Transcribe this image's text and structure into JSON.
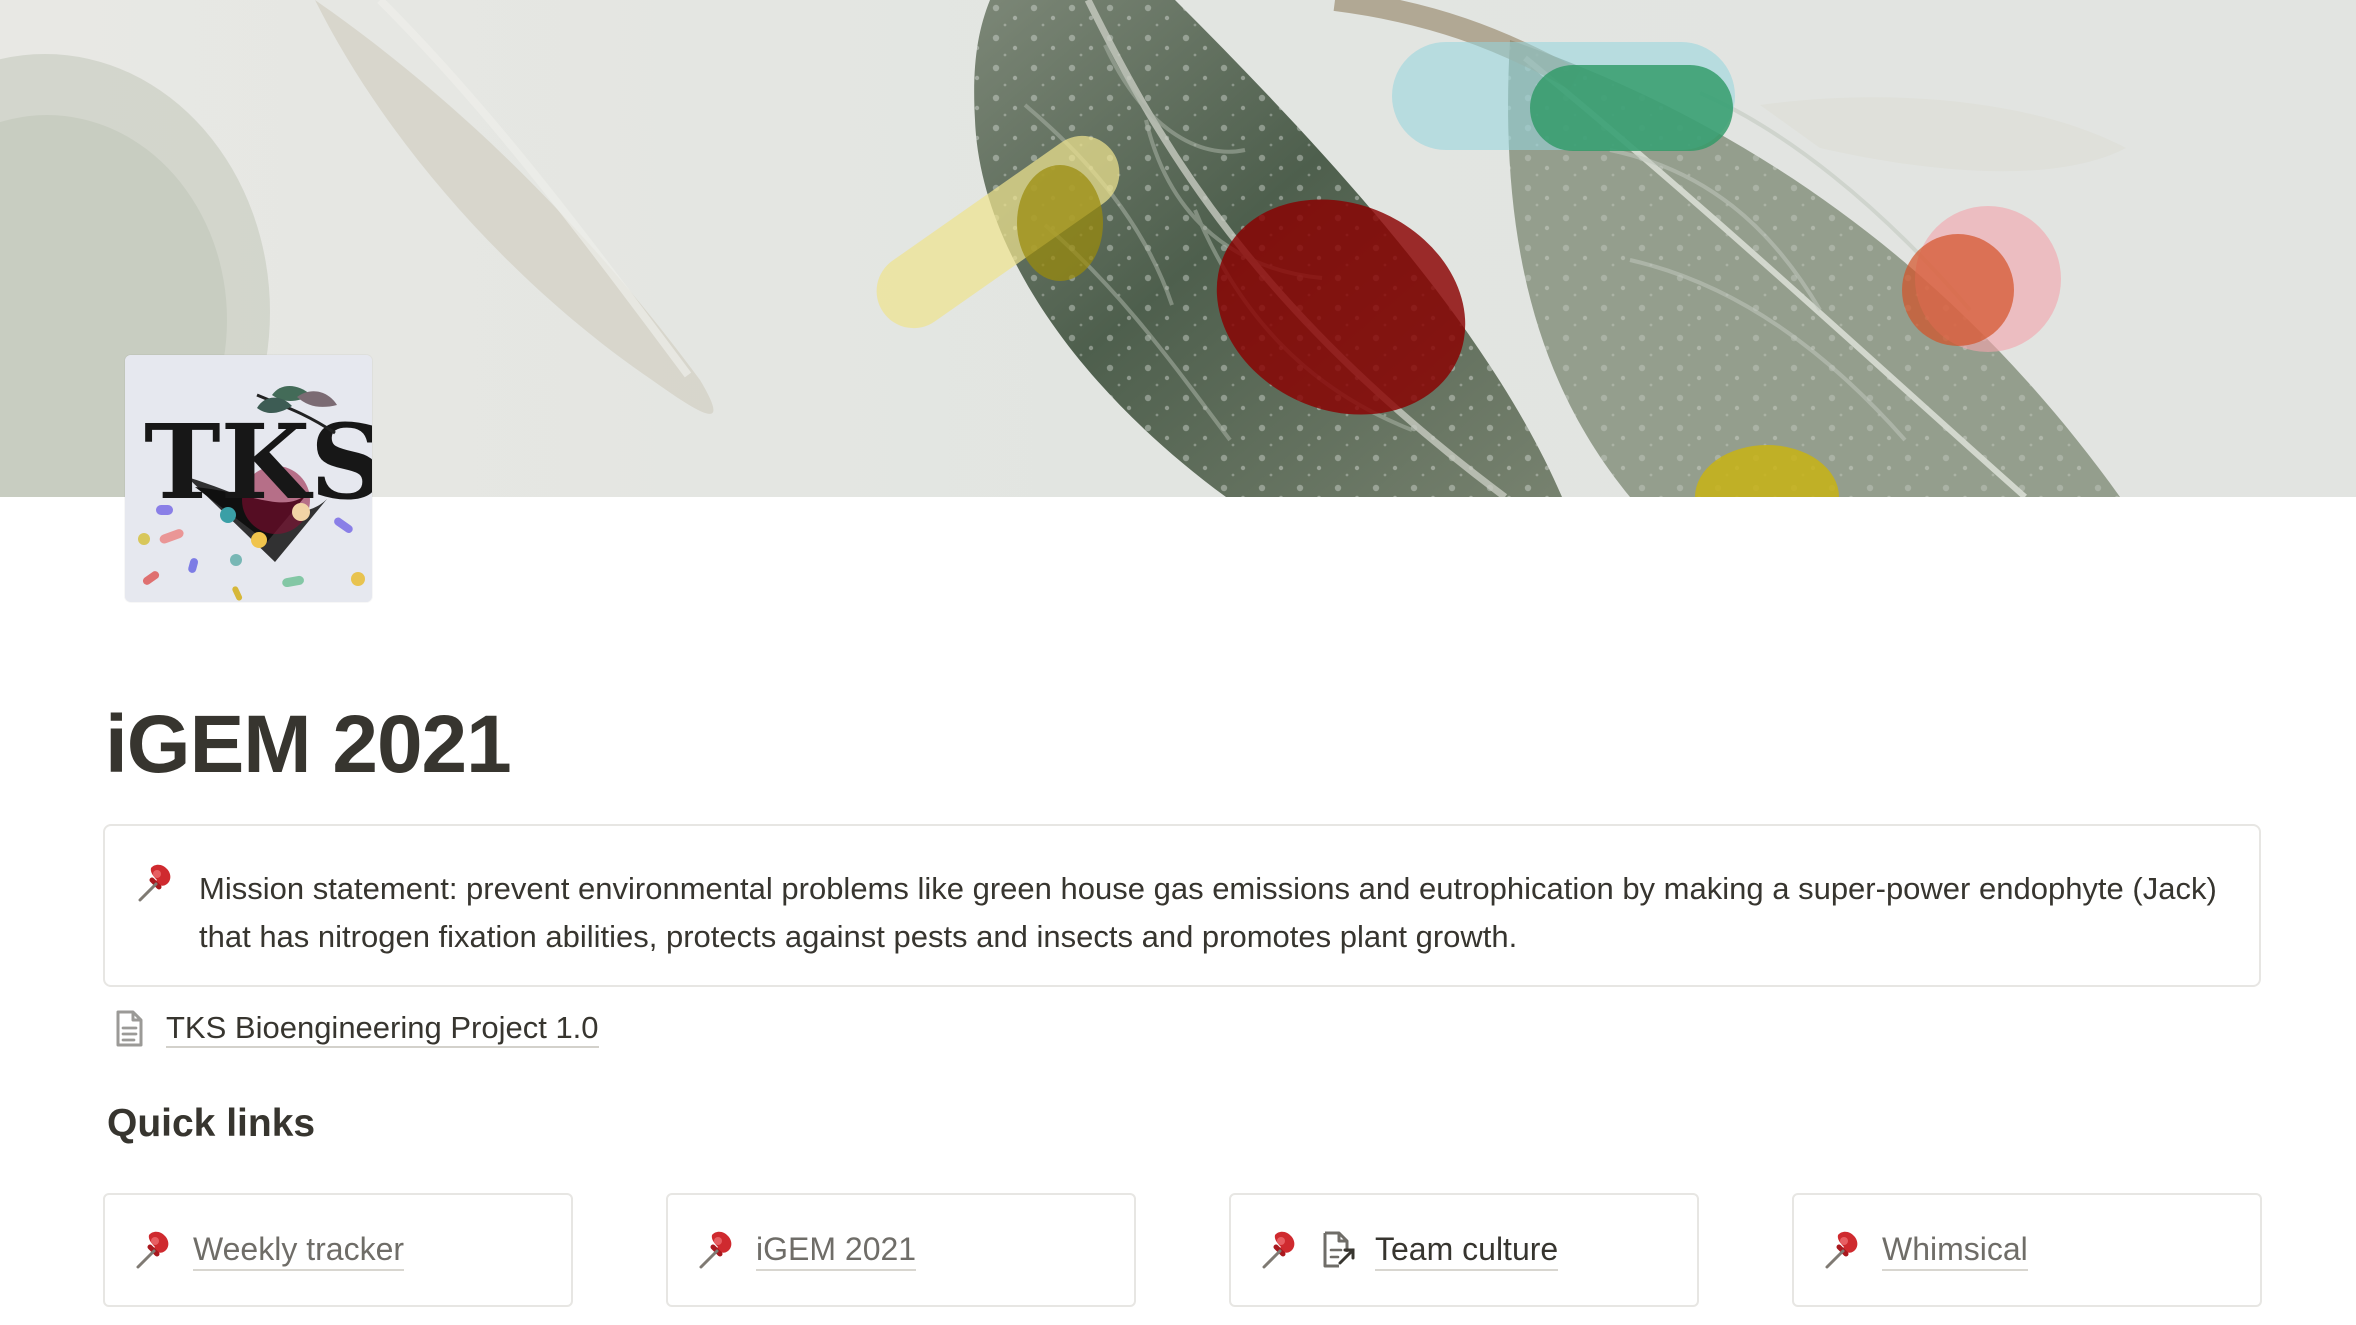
{
  "page": {
    "title": "iGEM 2021",
    "icon_name": "tks-logo-icon"
  },
  "cover": {
    "image_name": "leaf-cover-image",
    "colors": {
      "green": "#2f9a68",
      "teal": "#8fd0d3",
      "red": "#8a0000",
      "yellow": "#cfc32e",
      "pink": "#e5a0a1",
      "orange": "#d45127"
    }
  },
  "callout": {
    "icon_name": "pushpin-icon",
    "text": "Mission statement: prevent environmental problems like green house gas emissions and eutrophication by making a super-power endophyte (Jack) that has nitrogen fixation abilities, protects against pests and insects and promotes plant growth."
  },
  "subpage": {
    "icon_name": "document-icon",
    "label": "TKS Bioengineering Project 1.0"
  },
  "quick_links": {
    "heading": "Quick links",
    "items": [
      {
        "icon_name": "pushpin-icon",
        "label": "Weekly tracker"
      },
      {
        "icon_name": "pushpin-icon",
        "label": "iGEM 2021"
      },
      {
        "icon_name": "pushpin-icon",
        "secondary_icon_name": "page-link-icon",
        "label": "Team culture"
      },
      {
        "icon_name": "pushpin-icon",
        "label": "Whimsical"
      }
    ]
  },
  "logo": {
    "text": "TKS"
  }
}
